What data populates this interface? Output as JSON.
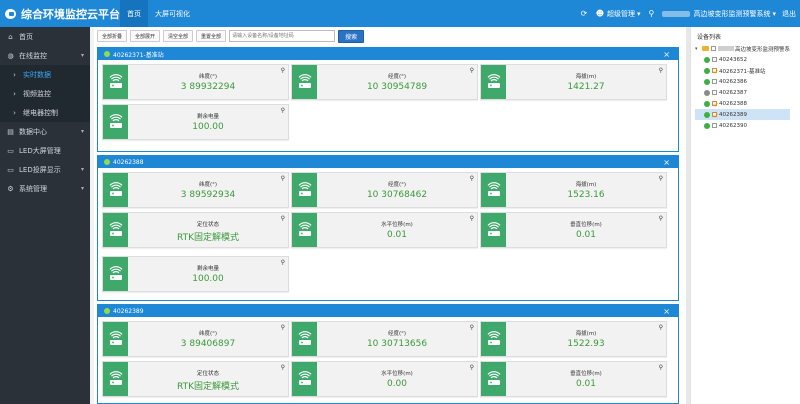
{
  "app": {
    "title": "综合环境监控云平台"
  },
  "topnav": {
    "tabs": [
      {
        "label": "首页",
        "active": true
      },
      {
        "label": "大屏可视化",
        "active": false
      }
    ]
  },
  "topright": {
    "user_label": "超级管理",
    "system_label": "高边坡变形监测预警系统",
    "logout_label": "退出"
  },
  "sidebar": {
    "items": [
      {
        "label": "首页",
        "icon": "home-icon"
      },
      {
        "label": "在线监控",
        "icon": "globe-icon",
        "expanded": true,
        "children": [
          {
            "label": "实时数据",
            "active": true
          },
          {
            "label": "视频监控"
          },
          {
            "label": "继电器控制"
          }
        ]
      },
      {
        "label": "数据中心",
        "icon": "database-icon"
      },
      {
        "label": "LED大屏管理",
        "icon": "monitor-icon"
      },
      {
        "label": "LED投屏显示",
        "icon": "display-icon"
      },
      {
        "label": "系统管理",
        "icon": "gear-icon"
      }
    ]
  },
  "toolbar": {
    "buttons": [
      "全部折叠",
      "全部展开",
      "清空全部",
      "重置全部"
    ],
    "search_placeholder": "请输入设备名称/设备地址码",
    "search_label": "搜索"
  },
  "panels": [
    {
      "title": "40262371-基准站",
      "cards": [
        {
          "label": "纬度(°)",
          "value": "3 89932294"
        },
        {
          "label": "经度(°)",
          "value": "10 30954789"
        },
        {
          "label": "海拔(m)",
          "value": "1421.27"
        },
        {
          "label": "剩余电量",
          "value": "100.00"
        }
      ]
    },
    {
      "title": "40262388",
      "cards": [
        {
          "label": "纬度(°)",
          "value": "3 89592934"
        },
        {
          "label": "经度(°)",
          "value": "10 30768462"
        },
        {
          "label": "海拔(m)",
          "value": "1523.16"
        },
        {
          "label": "定位状态",
          "value": "RTK固定解模式"
        },
        {
          "label": "水平位移(m)",
          "value": "0.01"
        },
        {
          "label": "垂直位移(m)",
          "value": "0.01"
        },
        {
          "label": "剩余电量",
          "value": "100.00"
        }
      ]
    },
    {
      "title": "40262389",
      "cards": [
        {
          "label": "纬度(°)",
          "value": "3 89406897"
        },
        {
          "label": "经度(°)",
          "value": "10 30713656"
        },
        {
          "label": "海拔(m)",
          "value": "1522.93"
        },
        {
          "label": "定位状态",
          "value": "RTK固定解模式"
        },
        {
          "label": "水平位移(m)",
          "value": "0.00"
        },
        {
          "label": "垂直位移(m)",
          "value": "0.01"
        }
      ]
    }
  ],
  "devices": {
    "title": "设备列表",
    "root": "高边坡变形监测预警系",
    "items": [
      {
        "label": "40243652",
        "status": "green",
        "checked": false
      },
      {
        "label": "40262371-基准站",
        "status": "green",
        "checked": true
      },
      {
        "label": "40262386",
        "status": "green",
        "checked": false
      },
      {
        "label": "40262387",
        "status": "gray",
        "checked": false
      },
      {
        "label": "40262388",
        "status": "green",
        "checked": true
      },
      {
        "label": "40262389",
        "status": "green",
        "checked": true,
        "selected": true
      },
      {
        "label": "40262390",
        "status": "green",
        "checked": false
      }
    ]
  },
  "colors": {
    "primary": "#1e87d6",
    "sidebar": "#2a3139",
    "card_icon": "#3fa86b",
    "value": "#3a9a3a"
  }
}
